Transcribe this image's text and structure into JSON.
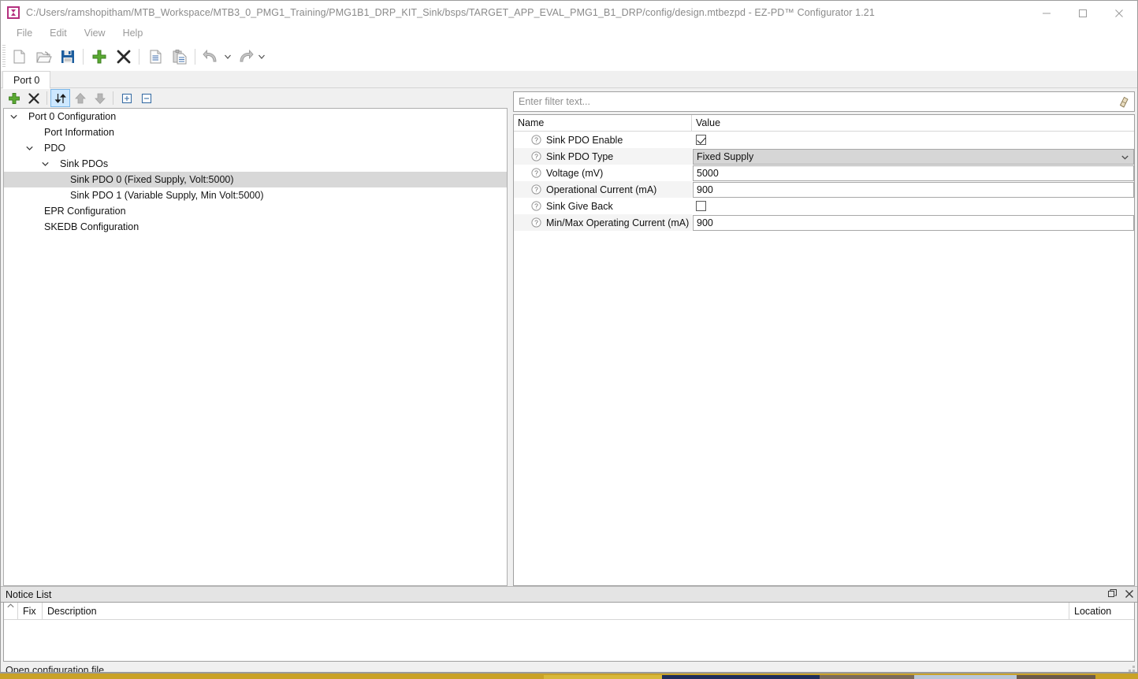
{
  "window": {
    "title": "C:/Users/ramshopitham/MTB_Workspace/MTB3_0_PMG1_Training/PMG1B1_DRP_KIT_Sink/bsps/TARGET_APP_EVAL_PMG1_B1_DRP/config/design.mtbezpd - EZ-PD™ Configurator 1.21",
    "app_icon": "ezpd-configurator-icon",
    "controls": {
      "minimize": "minimize-icon",
      "maximize": "maximize-icon",
      "close": "close-icon"
    }
  },
  "menubar": {
    "items": [
      {
        "label": "File"
      },
      {
        "label": "Edit"
      },
      {
        "label": "View"
      },
      {
        "label": "Help"
      }
    ]
  },
  "toolbar": {
    "buttons": [
      {
        "name": "new-file-button",
        "icon": "new-file-icon"
      },
      {
        "name": "open-file-button",
        "icon": "open-folder-icon"
      },
      {
        "name": "save-button",
        "icon": "save-floppy-icon"
      },
      {
        "name": "add-button",
        "icon": "plus-icon"
      },
      {
        "name": "delete-button",
        "icon": "x-delete-icon"
      },
      {
        "name": "copy-button",
        "icon": "copy-document-icon"
      },
      {
        "name": "paste-button",
        "icon": "paste-clipboard-icon"
      },
      {
        "name": "undo-button",
        "icon": "undo-arrow-icon"
      },
      {
        "name": "redo-button",
        "icon": "redo-arrow-icon"
      }
    ]
  },
  "tabs": {
    "items": [
      {
        "label": "Port 0",
        "active": true
      }
    ]
  },
  "tree_toolbar": {
    "buttons": [
      {
        "name": "tree-add-button",
        "icon": "plus-icon"
      },
      {
        "name": "tree-delete-button",
        "icon": "x-delete-icon"
      },
      {
        "name": "tree-sort-button",
        "icon": "sort-updown-icon",
        "active": true
      },
      {
        "name": "tree-move-up-button",
        "icon": "arrow-up-icon"
      },
      {
        "name": "tree-move-down-button",
        "icon": "arrow-down-icon"
      },
      {
        "name": "tree-expand-all-button",
        "icon": "expand-plus-box-icon"
      },
      {
        "name": "tree-collapse-all-button",
        "icon": "collapse-minus-box-icon"
      }
    ]
  },
  "tree": {
    "nodes": [
      {
        "label": "Port 0 Configuration",
        "depth": 0,
        "twisty": "expanded",
        "selected": false
      },
      {
        "label": "Port Information",
        "depth": 1,
        "twisty": "none",
        "selected": false
      },
      {
        "label": "PDO",
        "depth": 1,
        "twisty": "expanded",
        "selected": false
      },
      {
        "label": "Sink PDOs",
        "depth": 2,
        "twisty": "expanded",
        "selected": false
      },
      {
        "label": "Sink PDO 0 (Fixed Supply, Volt:5000)",
        "depth": 3,
        "twisty": "none",
        "selected": true
      },
      {
        "label": "Sink PDO 1 (Variable Supply, Min Volt:5000)",
        "depth": 3,
        "twisty": "none",
        "selected": false
      },
      {
        "label": "EPR Configuration",
        "depth": 1,
        "twisty": "none",
        "selected": false
      },
      {
        "label": "SKEDB Configuration",
        "depth": 1,
        "twisty": "none",
        "selected": false
      }
    ]
  },
  "filter": {
    "value": "",
    "placeholder": "Enter filter text...",
    "clear_icon": "eraser-icon"
  },
  "properties": {
    "columns": [
      "Name",
      "Value"
    ],
    "rows": [
      {
        "name": "Sink PDO Enable",
        "type": "checkbox",
        "value": "",
        "checked": true,
        "help": "help-icon"
      },
      {
        "name": "Sink PDO Type",
        "type": "combo",
        "value": "Fixed Supply",
        "checked": false,
        "help": "help-icon"
      },
      {
        "name": "Voltage (mV)",
        "type": "text",
        "value": "5000",
        "checked": false,
        "help": "help-icon"
      },
      {
        "name": "Operational Current (mA)",
        "type": "text",
        "value": "900",
        "checked": false,
        "help": "help-icon"
      },
      {
        "name": "Sink Give Back",
        "type": "checkbox",
        "value": "",
        "checked": false,
        "help": "help-icon"
      },
      {
        "name": "Min/Max Operating Current (mA)",
        "type": "text",
        "value": "900",
        "checked": false,
        "help": "help-icon"
      }
    ]
  },
  "notice_list": {
    "title": "Notice List",
    "actions": {
      "restore": "restore-panel-icon",
      "close": "close-icon"
    },
    "columns": [
      "Fix",
      "Description",
      "Location"
    ],
    "sort_indicator": "sort-ascending-icon",
    "rows": []
  },
  "statusbar": {
    "message": "Open configuration file.",
    "grip": "resize-grip-icon"
  },
  "colors": {
    "accent_magenta": "#b4307f",
    "selection_gray": "#d8d8d8",
    "active_tool_blue": "#cde8ff",
    "combo_gray": "#d6d6d6"
  }
}
